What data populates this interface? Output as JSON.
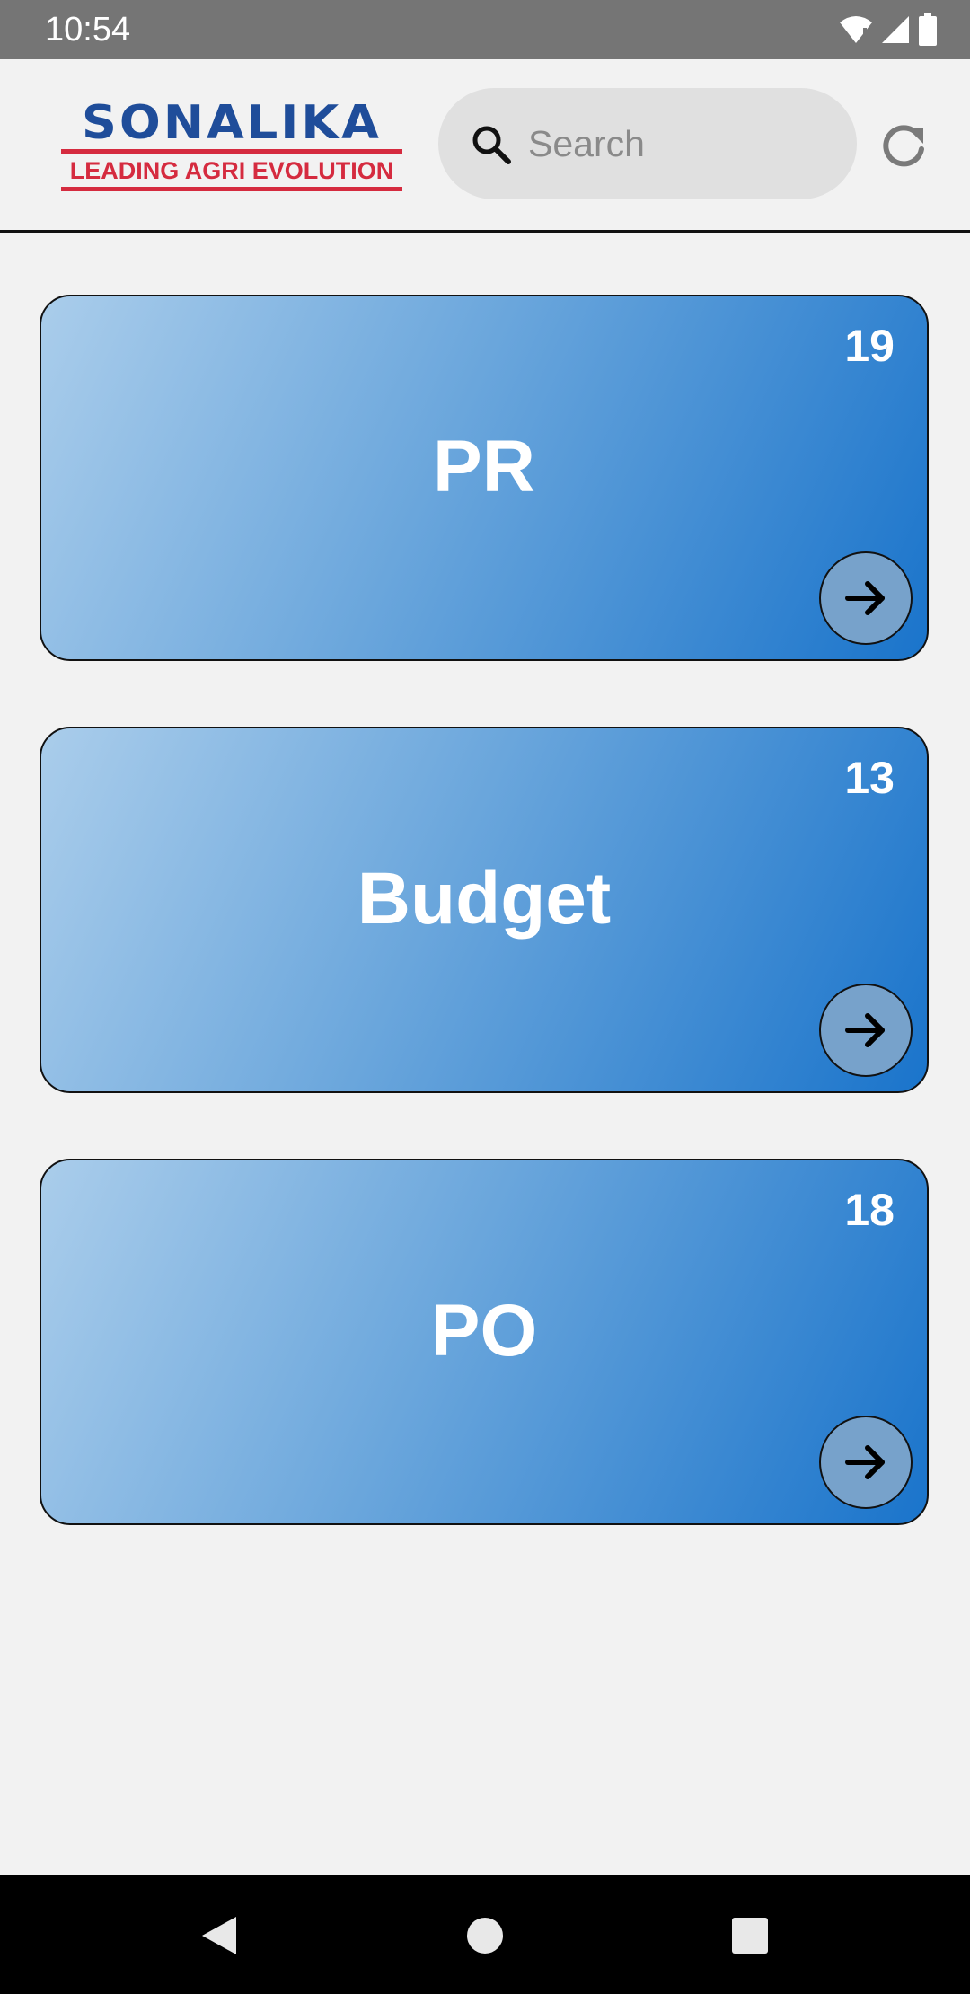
{
  "status_bar": {
    "time": "10:54",
    "icons": [
      "wifi-icon",
      "signal-icon",
      "battery-icon"
    ]
  },
  "header": {
    "logo": {
      "name": "SONALIKA",
      "tagline": "LEADING AGRI EVOLUTION"
    },
    "search": {
      "placeholder": "Search",
      "value": ""
    },
    "refresh_icon": "refresh-icon"
  },
  "cards": [
    {
      "label": "PR",
      "count": "19",
      "icon": "arrow-right-icon"
    },
    {
      "label": "Budget",
      "count": "13",
      "icon": "arrow-right-icon"
    },
    {
      "label": "PO",
      "count": "18",
      "icon": "arrow-right-icon"
    }
  ],
  "nav_bar": {
    "buttons": [
      "back-icon",
      "home-icon",
      "recents-icon"
    ]
  },
  "colors": {
    "status_bar": "#757575",
    "background": "#f2f2f2",
    "logo_blue": "#1f4d9a",
    "logo_red": "#d52b3f",
    "card_gradient_start": "#aacdeb",
    "card_gradient_end": "#1a74cb",
    "arrow_circle": "#77a2cb"
  }
}
